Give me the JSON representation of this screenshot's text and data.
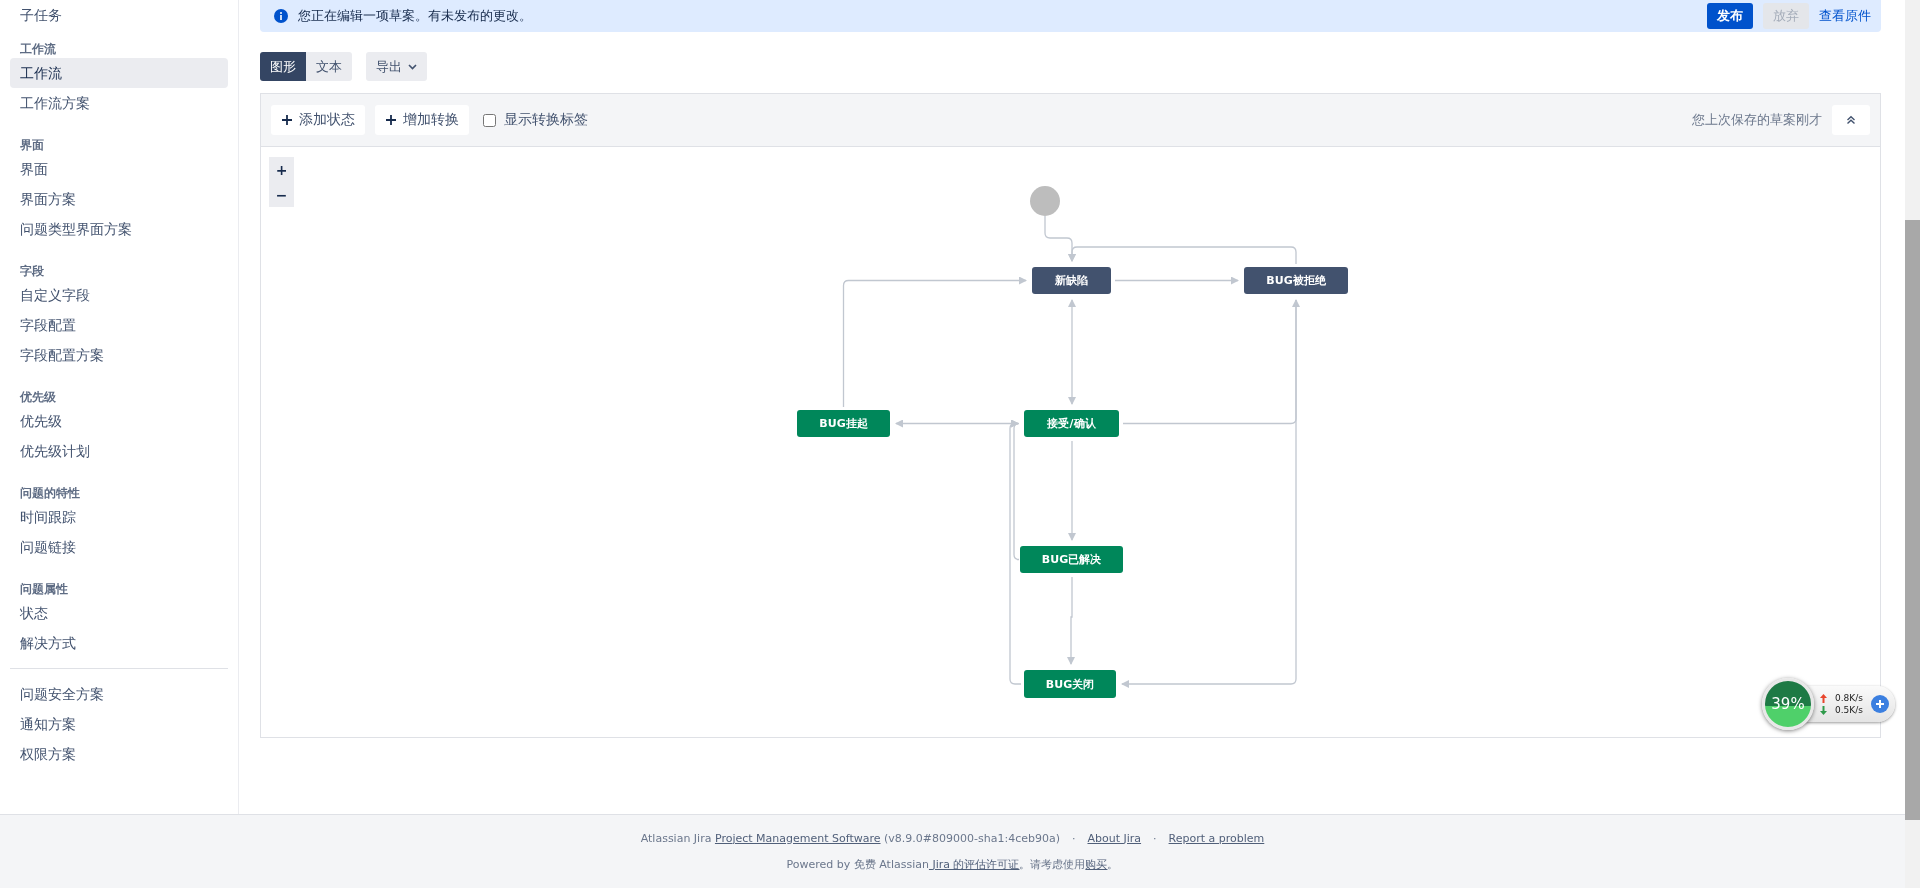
{
  "sidebar": {
    "top_item": {
      "label": "子任务",
      "selected": false
    },
    "groups": [
      {
        "heading": "工作流",
        "items": [
          {
            "label": "工作流",
            "selected": true
          },
          {
            "label": "工作流方案",
            "selected": false
          }
        ]
      },
      {
        "heading": "界面",
        "items": [
          {
            "label": "界面",
            "selected": false
          },
          {
            "label": "界面方案",
            "selected": false
          },
          {
            "label": "问题类型界面方案",
            "selected": false
          }
        ]
      },
      {
        "heading": "字段",
        "items": [
          {
            "label": "自定义字段",
            "selected": false
          },
          {
            "label": "字段配置",
            "selected": false
          },
          {
            "label": "字段配置方案",
            "selected": false
          }
        ]
      },
      {
        "heading": "优先级",
        "items": [
          {
            "label": "优先级",
            "selected": false
          },
          {
            "label": "优先级计划",
            "selected": false
          }
        ]
      },
      {
        "heading": "问题的特性",
        "items": [
          {
            "label": "时间跟踪",
            "selected": false
          },
          {
            "label": "问题链接",
            "selected": false
          }
        ]
      },
      {
        "heading": "问题属性",
        "items": [
          {
            "label": "状态",
            "selected": false
          },
          {
            "label": "解决方式",
            "selected": false
          }
        ]
      }
    ],
    "bottom_items": [
      {
        "label": "问题安全方案",
        "selected": false
      },
      {
        "label": "通知方案",
        "selected": false
      },
      {
        "label": "权限方案",
        "selected": false
      }
    ]
  },
  "banner": {
    "message": "您正在编辑一项草案。有未发布的更改。",
    "publish": "发布",
    "discard": "放弃",
    "view_original": "查看原件"
  },
  "view_tabs": [
    {
      "label": "图形",
      "selected": true
    },
    {
      "label": "文本",
      "selected": false
    }
  ],
  "export": {
    "label": "导出"
  },
  "toolbar": {
    "add_status": "添加状态",
    "add_transition": "增加转换",
    "show_labels": {
      "label": "显示转换标签",
      "checked": false
    },
    "saved_note": "您上次保存的草案刚才"
  },
  "zoom": {
    "in": "+",
    "out": "−"
  },
  "diagram": {
    "nodes": [
      {
        "label": "新缺陷",
        "kind": "todo"
      },
      {
        "label": "BUG被拒绝",
        "kind": "todo"
      },
      {
        "label": "BUG挂起",
        "kind": "done"
      },
      {
        "label": "接受/确认",
        "kind": "done"
      },
      {
        "label": "BUG已解决",
        "kind": "done"
      },
      {
        "label": "BUG关闭",
        "kind": "done"
      }
    ]
  },
  "network_widget": {
    "percent": "39%",
    "upload": "0.8K/s",
    "download": "0.5K/s"
  },
  "footer": {
    "version_line": [
      {
        "text": "Atlassian Jira ",
        "link": false
      },
      {
        "text": "Project Management Software",
        "link": true
      },
      {
        "text": " (v8.9.0#809000-sha1:4ceb90a)",
        "link": false
      }
    ],
    "separator": "·",
    "links": [
      "About Jira",
      "Report a problem"
    ],
    "license_line": [
      {
        "text": "Powered by 免费 Atlassian",
        "link": false
      },
      {
        "text": " Jira 的评估许可证",
        "link": true
      },
      {
        "text": "。请考虑使用",
        "link": false
      },
      {
        "text": "购买",
        "link": true
      },
      {
        "text": "。",
        "link": false
      }
    ]
  }
}
